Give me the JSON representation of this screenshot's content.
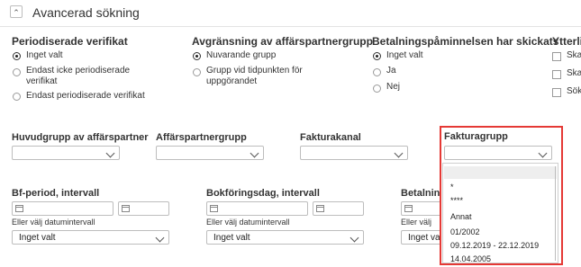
{
  "header": {
    "title": "Avancerad sökning",
    "collapse_icon": "chevron-up-icon"
  },
  "groups": [
    {
      "title": "Periodiserade verifikat",
      "options": [
        "Inget valt",
        "Endast icke periodiserade verifikat",
        "Endast periodiserade verifikat"
      ],
      "selected": 0
    },
    {
      "title": "Avgränsning av affärspartnergrupp",
      "options": [
        "Nuvarande grupp",
        "Grupp vid tidpunkten för uppgörandet"
      ],
      "selected": 0
    },
    {
      "title": "Betalningspåminnelsen har skickats",
      "options": [
        "Inget valt",
        "Ja",
        "Nej"
      ],
      "selected": 0
    },
    {
      "title": "Ytterlig",
      "checkboxes": [
        "Ska",
        "Ska",
        "Sök"
      ]
    }
  ],
  "fields": {
    "huvudgrupp": {
      "label": "Huvudgrupp av affärspartner",
      "value": ""
    },
    "affarspartnergrupp": {
      "label": "Affärspartnergrupp",
      "value": ""
    },
    "fakturakanal": {
      "label": "Fakturakanal",
      "value": ""
    },
    "fakturagrupp": {
      "label": "Fakturagrupp",
      "value": "",
      "options": [
        "",
        "*",
        "****",
        "Annat",
        "01/2002",
        "09.12.2019 - 22.12.2019",
        "14.04.2005"
      ]
    }
  },
  "bf_period": {
    "label": "Bf-period, intervall",
    "range_label": "Eller välj datumintervall",
    "select_value": "Inget valt"
  },
  "bokforingsdag": {
    "label": "Bokföringsdag, intervall",
    "range_label": "Eller välj datumintervall",
    "select_value": "Inget valt"
  },
  "betalning": {
    "label": "Betalnings",
    "range_label": "Eller välj",
    "select_value": "Inget valt"
  },
  "colors": {
    "highlight": "#e53935"
  }
}
